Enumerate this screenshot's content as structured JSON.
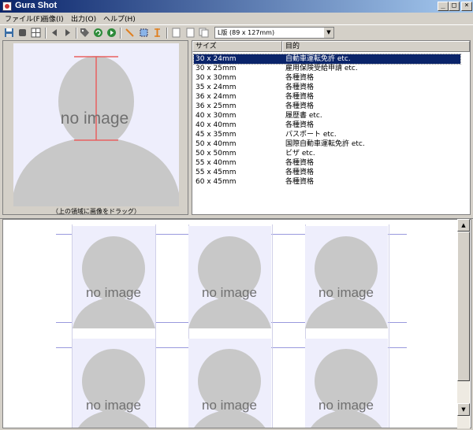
{
  "window": {
    "title": "Gura Shot",
    "minimize": "_",
    "maximize": "□",
    "close": "×"
  },
  "menu": [
    {
      "label": "ファイル(F)"
    },
    {
      "label": "画像(I)"
    },
    {
      "label": "出力(O)"
    },
    {
      "label": "ヘルプ(H)"
    }
  ],
  "toolbar": {
    "paper_size": "L版 (89 x 127mm)",
    "icons": [
      "save-icon",
      "stop-icon",
      "grid-icon",
      "prev-icon",
      "next-icon",
      "tag-icon",
      "refresh-icon",
      "forward-icon",
      "ruler-diagonal-icon",
      "crop-icon",
      "ruler-vertical-icon",
      "page-icon",
      "page-icon",
      "copy-pages-icon"
    ]
  },
  "preview": {
    "placeholder": "no image",
    "hint": "（上の領域に画像をドラッグ）"
  },
  "size_list": {
    "columns": [
      "サイズ",
      "目的"
    ],
    "selected_index": 0,
    "rows": [
      {
        "size": "30 x 24mm",
        "purpose": "自動車運転免許 etc."
      },
      {
        "size": "30 x 25mm",
        "purpose": "雇用保険受給申請 etc."
      },
      {
        "size": "30 x 30mm",
        "purpose": "各種資格"
      },
      {
        "size": "35 x 24mm",
        "purpose": "各種資格"
      },
      {
        "size": "36 x 24mm",
        "purpose": "各種資格"
      },
      {
        "size": "36 x 25mm",
        "purpose": "各種資格"
      },
      {
        "size": "40 x 30mm",
        "purpose": "履歴書 etc."
      },
      {
        "size": "40 x 40mm",
        "purpose": "各種資格"
      },
      {
        "size": "45 x 35mm",
        "purpose": "パスポート etc."
      },
      {
        "size": "50 x 40mm",
        "purpose": "国際自動車運転免許 etc."
      },
      {
        "size": "50 x 50mm",
        "purpose": "ビザ etc."
      },
      {
        "size": "55 x 40mm",
        "purpose": "各種資格"
      },
      {
        "size": "55 x 45mm",
        "purpose": "各種資格"
      },
      {
        "size": "60 x 45mm",
        "purpose": "各種資格"
      }
    ]
  },
  "layout": {
    "placeholder": "no image",
    "photos": 6
  },
  "colors": {
    "selection": "#0a246a",
    "placeholder_bg": "#eeeefc",
    "silhouette": "#c8c8c8",
    "guide": "#e86060"
  }
}
